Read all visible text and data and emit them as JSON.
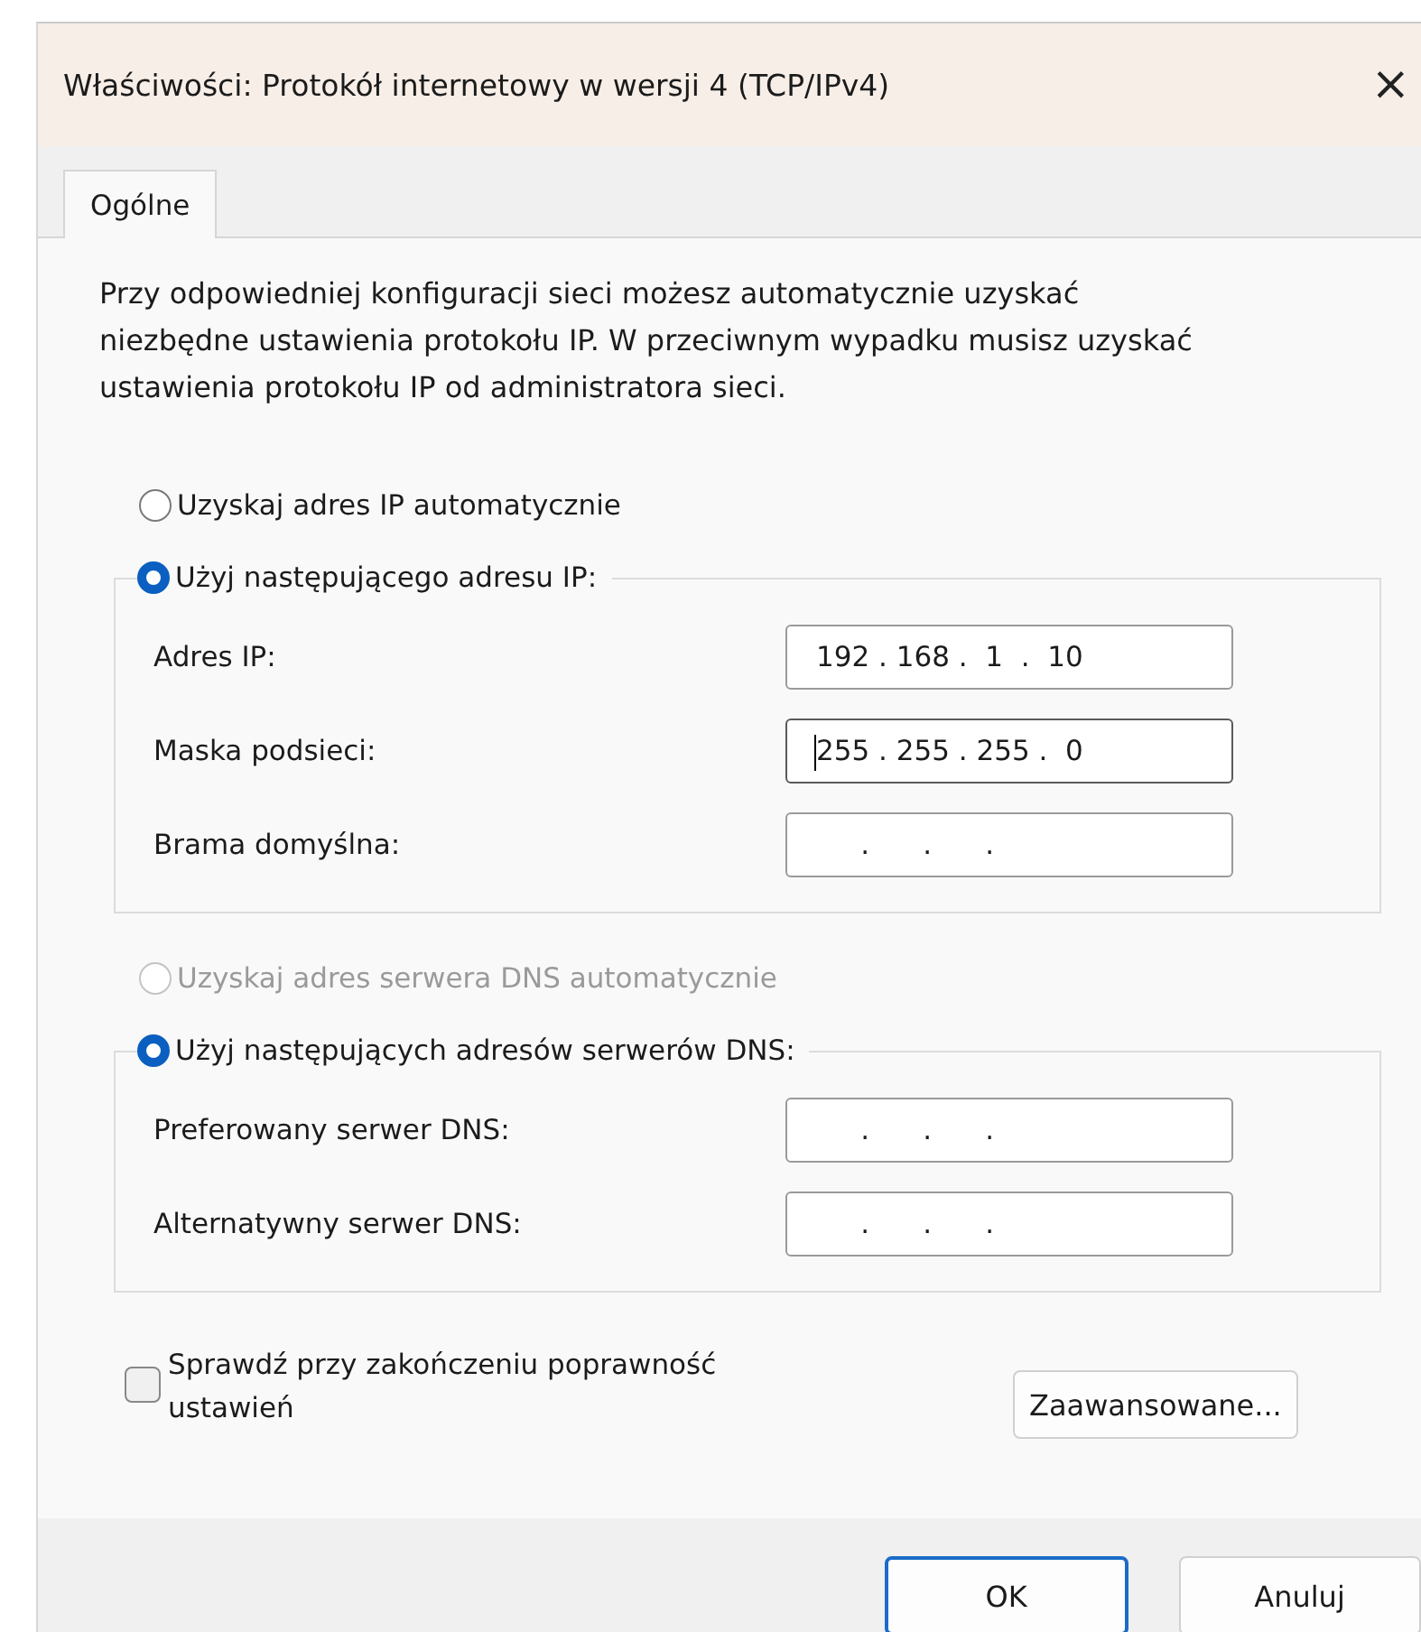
{
  "window": {
    "title": "Właściwości: Protokół internetowy w wersji 4 (TCP/IPv4)",
    "close": "×"
  },
  "tabs": [
    {
      "label": "Ogólne",
      "selected": true
    }
  ],
  "description": "Przy odpowiedniej konfiguracji sieci możesz automatycznie uzyskać niezbędne ustawienia protokołu IP. W przeciwnym wypadku musisz uzyskać ustawienia protokołu IP od administratora sieci.",
  "ip_section": {
    "auto_option": {
      "label": "Uzyskaj adres IP automatycznie",
      "selected": false,
      "disabled": false
    },
    "manual_option": {
      "label": "Użyj następującego adresu IP:",
      "selected": true
    },
    "fields": [
      {
        "label": "Adres IP:",
        "value": "192 . 168 .  1  .  10",
        "focused": false
      },
      {
        "label": "Maska podsieci:",
        "value": "255 . 255 . 255 .  0",
        "focused": true
      },
      {
        "label": "Brama domyślna:",
        "value": "     .      .      .",
        "focused": false
      }
    ]
  },
  "dns_section": {
    "auto_option": {
      "label": "Uzyskaj adres serwera DNS automatycznie",
      "selected": false,
      "disabled": true
    },
    "manual_option": {
      "label": "Użyj następujących adresów serwerów DNS:",
      "selected": true
    },
    "fields": [
      {
        "label": "Preferowany serwer DNS:",
        "value": "     .      .      .",
        "focused": false
      },
      {
        "label": "Alternatywny serwer DNS:",
        "value": "     .      .      .",
        "focused": false
      }
    ]
  },
  "validate": {
    "label": "Sprawdź przy zakończeniu poprawność ustawień",
    "checked": false
  },
  "advanced_button": "Zaawansowane...",
  "buttons": [
    {
      "label": "OK",
      "default": true
    },
    {
      "label": "Anuluj",
      "default": false
    }
  ]
}
